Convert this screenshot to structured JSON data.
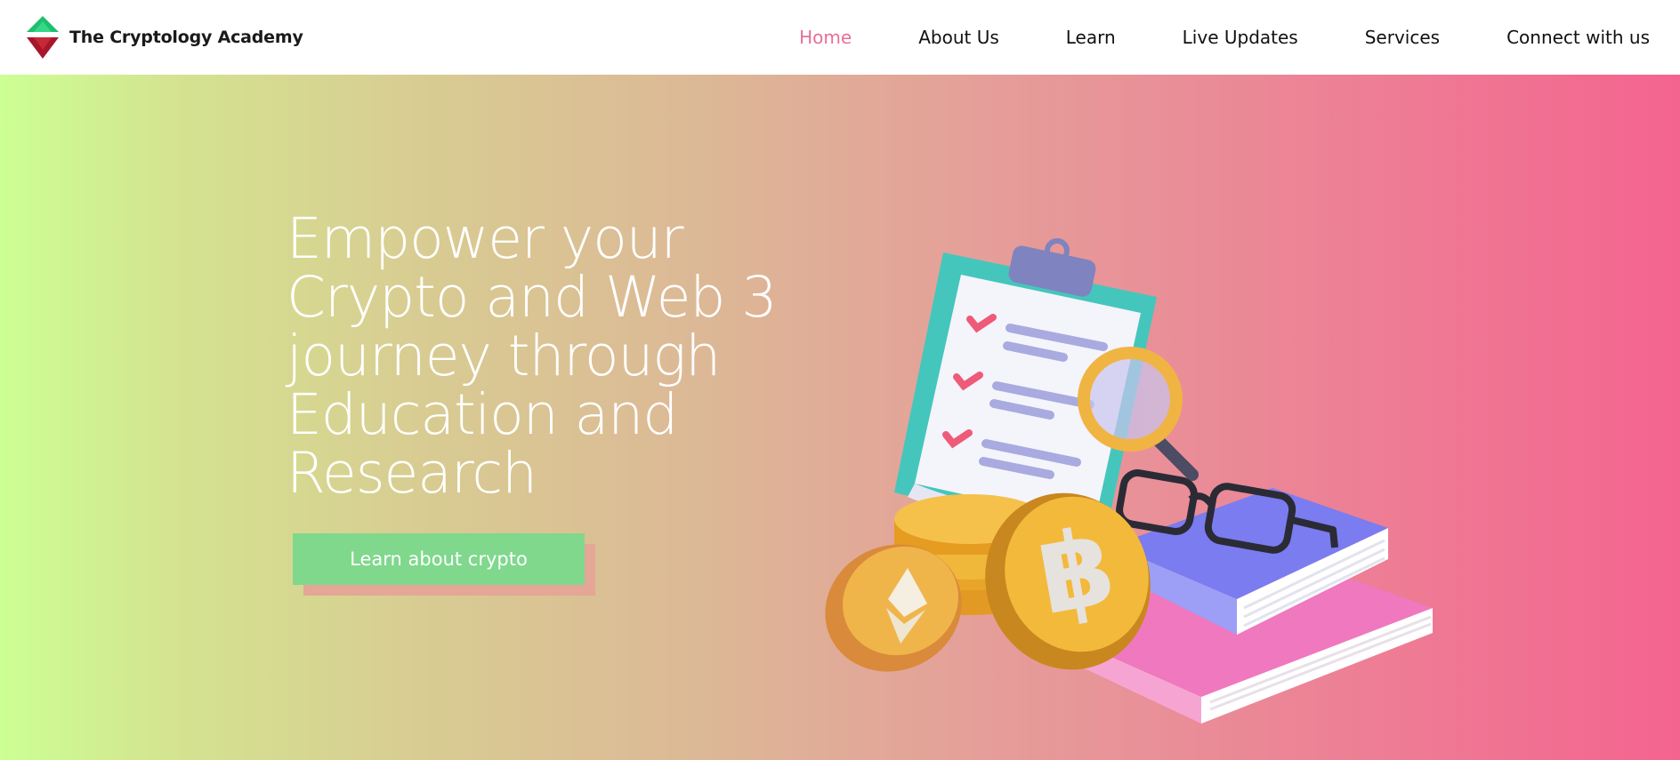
{
  "header": {
    "brand_name": "The Cryptology Academy",
    "logo_icon": "diamond-logo-icon"
  },
  "nav": {
    "items": [
      {
        "label": "Home",
        "active": true
      },
      {
        "label": "About Us",
        "active": false
      },
      {
        "label": "Learn",
        "active": false
      },
      {
        "label": "Live Updates",
        "active": false
      },
      {
        "label": "Services",
        "active": false
      },
      {
        "label": "Connect with us",
        "active": false
      }
    ],
    "active_color": "#e86f98"
  },
  "hero": {
    "title": "Empower your Crypto and Web 3 journey through Education and Research",
    "cta_label": "Learn about crypto",
    "gradient_start": "#ccff94",
    "gradient_end": "#f4648f",
    "cta_color": "#7fd88c",
    "illustration_icons": [
      "clipboard-icon",
      "magnifier-icon",
      "glasses-icon",
      "books-icon",
      "bitcoin-coin-icon",
      "ethereum-coin-icon"
    ]
  }
}
